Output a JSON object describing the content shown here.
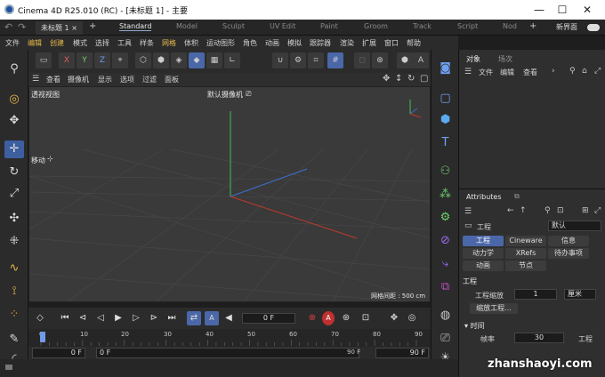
{
  "titlebar": {
    "title": "Cinema 4D R25.010 (RC) - [未标题 1] - 主要",
    "minimize": "—",
    "maximize": "☐",
    "close": "✕"
  },
  "tabs": {
    "document": "未标题 1",
    "close_doc": "×",
    "add": "+",
    "layouts": [
      "Standard",
      "Model",
      "Sculpt",
      "UV Edit",
      "Paint",
      "Groom",
      "Track",
      "Script",
      "Nod"
    ],
    "more": "+",
    "new_interface": "新界面"
  },
  "menu": [
    "文件",
    "编辑",
    "创建",
    "模式",
    "选择",
    "工具",
    "样条",
    "网格",
    "体积",
    "运动图形",
    "角色",
    "动画",
    "模拟",
    "跟踪器",
    "渲染",
    "扩展",
    "窗口",
    "帮助"
  ],
  "toolbar": {
    "x": "X",
    "y": "Y",
    "z": "Z"
  },
  "viewport_menu": [
    "查看",
    "摄像机",
    "显示",
    "选项",
    "过滤",
    "面板"
  ],
  "viewport": {
    "name": "透视视图",
    "camera": "默认摄像机",
    "camera_icon": "camera-icon",
    "tool_label": "移动",
    "grid_spacing": "网格间距 : 500 cm"
  },
  "timeline": {
    "current_frame": "0 F",
    "ticks": [
      "0",
      "10",
      "20",
      "30",
      "40",
      "50",
      "60",
      "70",
      "80",
      "90"
    ],
    "range_start": "0 F",
    "range_min": "0 F",
    "range_max": "90 F",
    "range_end": "90 F"
  },
  "objects_panel": {
    "tabs": [
      "对象",
      "场次"
    ],
    "menu": [
      "文件",
      "编辑",
      "查看"
    ]
  },
  "attributes_panel": {
    "tab": "Attributes",
    "mode_label": "工程",
    "mode_value": "默认",
    "tabs_row1": [
      "工程",
      "Cineware",
      "信息"
    ],
    "tabs_row2": [
      "动力学",
      "XRefs",
      "待办事项"
    ],
    "tabs_row3": [
      "动画",
      "节点"
    ],
    "section": "工程",
    "scale_label": "工程缩放",
    "scale_value": "1",
    "scale_unit": "厘米",
    "scale_button": "缩放工程...",
    "time_section": "时间",
    "fps_label": "帧率",
    "fps_value": "30",
    "truncated_label": "工程"
  },
  "watermark": "zhanshaoyi.com",
  "colors": {
    "accent": "#4a67a8",
    "highlight_menu": "#e6b84a",
    "axis_x": "#c0392b",
    "axis_y": "#2ecc71",
    "axis_z": "#3b6fd1"
  }
}
